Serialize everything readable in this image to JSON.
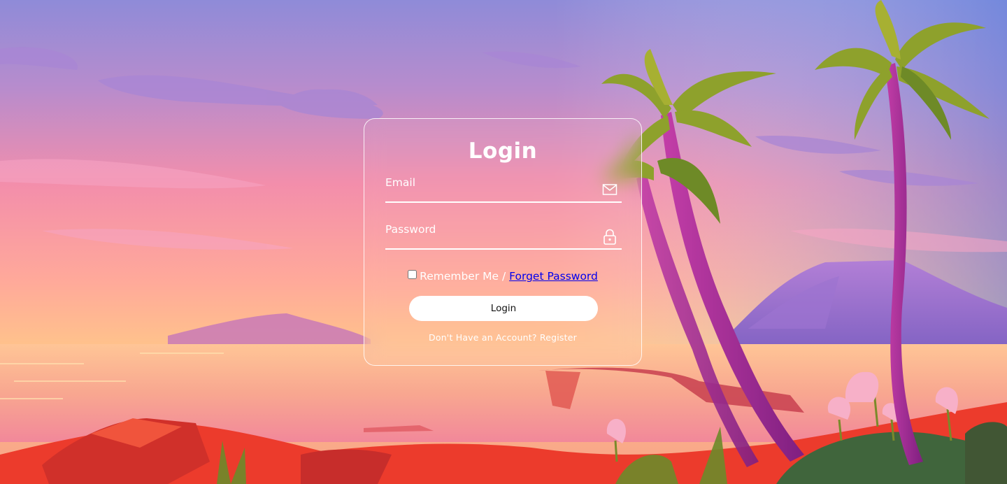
{
  "login": {
    "title": "Login",
    "email_label": "Email",
    "password_label": "Password",
    "remember_label": "Remember Me",
    "separator": " / ",
    "forget_label": "Forget Password",
    "button_label": "Login",
    "no_account_text": "Don't Have an Account?",
    "register_label": "Register"
  },
  "icons": {
    "email": "envelope-icon",
    "password": "lock-icon"
  },
  "colors": {
    "sky_top": "#7a7fd6",
    "sky_mid": "#f38aa8",
    "sky_low": "#ffb98a",
    "sea": "#f7b18a",
    "sand": "#e9352b",
    "palm_leaf": "#8ca02a",
    "palm_trunk": "#a43192",
    "card_border": "#ffffff",
    "button_bg": "#ffffff"
  }
}
